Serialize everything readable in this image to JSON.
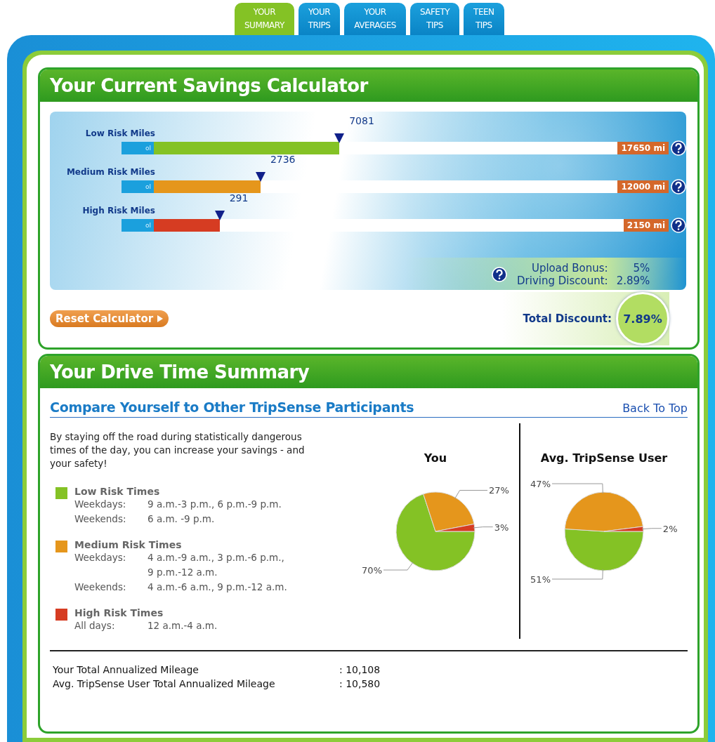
{
  "tabs": [
    {
      "lines": [
        "YOUR",
        "SUMMARY"
      ],
      "selected": true
    },
    {
      "lines": [
        "YOUR",
        "TRIPS"
      ],
      "selected": false
    },
    {
      "lines": [
        "YOUR",
        "AVERAGES"
      ],
      "selected": false
    },
    {
      "lines": [
        "SAFETY",
        "TIPS"
      ],
      "selected": false
    },
    {
      "lines": [
        "TEEN",
        "TIPS"
      ],
      "selected": false
    }
  ],
  "calculator": {
    "title": "Your Current Savings Calculator",
    "sliders": [
      {
        "label": "Low Risk Miles",
        "reading": "7081",
        "min_label": "ol",
        "max": "17650 mi",
        "level": 0.4,
        "color": "#84c225"
      },
      {
        "label": "Medium Risk Miles",
        "reading": "2736",
        "min_label": "ol",
        "max": "12000 mi",
        "level": 0.23,
        "color": "#e5961c"
      },
      {
        "label": "High Risk Miles",
        "reading": "291",
        "min_label": "ol",
        "max": "2150 mi",
        "level": 0.14,
        "color": "#d63c22"
      }
    ],
    "bonuses": [
      {
        "label": "Upload Bonus:",
        "value": "5%"
      },
      {
        "label": "Driving Discount:",
        "value": "2.89%"
      }
    ],
    "reset_button": "Reset Calculator",
    "total": {
      "label": "Total Discount:",
      "value": "7.89%"
    }
  },
  "summary": {
    "title": "Your Drive Time Summary",
    "heading": "Compare Yourself to Other TripSense Participants",
    "back_link": "Back To Top",
    "intro": "By staying off the road during statistically dangerous times of the day, you can increase your savings - and your safety!",
    "legend": [
      {
        "title": "Low Risk Times",
        "color": "#84c225",
        "rows": [
          {
            "day": "Weekdays:",
            "times": [
              "9 a.m.-3 p.m., 6 p.m.-9 p.m."
            ]
          },
          {
            "day": "Weekends:",
            "times": [
              "6 a.m. -9 p.m."
            ]
          }
        ]
      },
      {
        "title": "Medium Risk Times",
        "color": "#e5961c",
        "rows": [
          {
            "day": "Weekdays:",
            "times": [
              "4 a.m.-9 a.m., 3 p.m.-6 p.m.,",
              "9 p.m.-12 a.m."
            ]
          },
          {
            "day": "Weekends:",
            "times": [
              "4 a.m.-6 a.m., 9 p.m.-12 a.m."
            ]
          }
        ]
      },
      {
        "title": "High Risk Times",
        "color": "#d63c22",
        "rows": [
          {
            "day": "All days:",
            "times": [
              "12 a.m.-4 a.m."
            ]
          }
        ]
      }
    ],
    "charts": [
      {
        "chart_data": {
          "type": "pie",
          "title": "You",
          "values": [
            70,
            27,
            3
          ],
          "value_labels": [
            "70%",
            "27%",
            "3%"
          ]
        }
      },
      {
        "chart_data": {
          "type": "pie",
          "title": "Avg. TripSense User",
          "values": [
            51,
            47,
            2
          ],
          "value_labels": [
            "51%",
            "47%",
            "2%"
          ]
        }
      }
    ],
    "totals": [
      {
        "label": "Your Total Annualized Mileage",
        "value": ": 10,108"
      },
      {
        "label": "Avg. TripSense User Total Annualized Mileage",
        "value": ": 10,580"
      }
    ]
  }
}
